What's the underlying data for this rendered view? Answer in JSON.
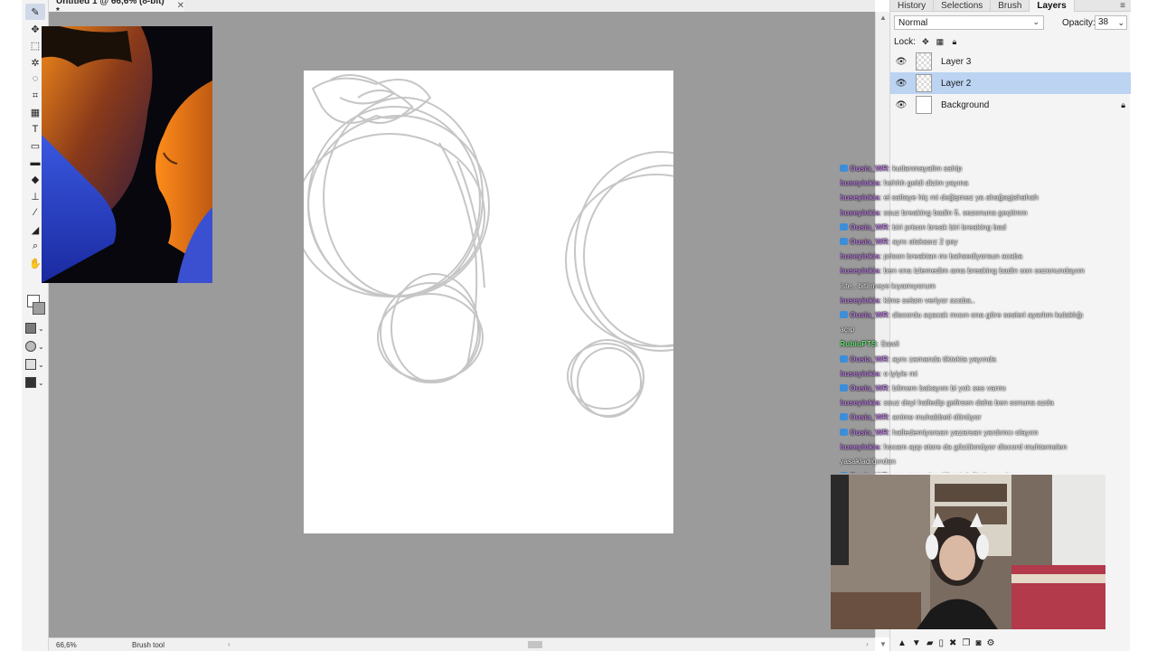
{
  "document": {
    "tab_title": "Untitled 1 @ 66,6% (8-bit) *",
    "close_glyph": "✕"
  },
  "tools": [
    {
      "name": "brush-tool",
      "glyph": "✎",
      "active": true
    },
    {
      "name": "move-tool",
      "glyph": "✥"
    },
    {
      "name": "marquee-tool",
      "glyph": "⬚"
    },
    {
      "name": "magic-wand-tool",
      "glyph": "✲"
    },
    {
      "name": "lasso-tool",
      "glyph": "◌"
    },
    {
      "name": "crop-tool",
      "glyph": "⌗"
    },
    {
      "name": "grid-tool",
      "glyph": "▦"
    },
    {
      "name": "text-tool",
      "glyph": "T"
    },
    {
      "name": "shape-tool",
      "glyph": "▭"
    },
    {
      "name": "gradient-tool",
      "glyph": "▬"
    },
    {
      "name": "eraser-tool",
      "glyph": "◆"
    },
    {
      "name": "clone-stamp-tool",
      "glyph": "⊥"
    },
    {
      "name": "eyedropper-tool",
      "glyph": "⁄"
    },
    {
      "name": "fill-tool",
      "glyph": "◢"
    },
    {
      "name": "zoom-tool",
      "glyph": "⌕"
    },
    {
      "name": "hand-tool",
      "glyph": "✋"
    }
  ],
  "status": {
    "zoom": "66,6%",
    "tool_name": "Brush tool"
  },
  "panel": {
    "tabs": [
      "History",
      "Selections",
      "Brush",
      "Layers"
    ],
    "active_tab": "Layers",
    "menu_glyph": "≡",
    "blend_mode": "Normal",
    "opacity_label": "Opacity:",
    "opacity_value": "38",
    "lock_label": "Lock:",
    "layers": [
      {
        "name": "Layer 3",
        "visible": true,
        "selected": false,
        "locked": false
      },
      {
        "name": "Layer 2",
        "visible": true,
        "selected": true,
        "locked": false
      },
      {
        "name": "Background",
        "visible": true,
        "selected": false,
        "locked": true
      }
    ]
  },
  "chat": [
    {
      "badge": true,
      "user": "Ousia_WR",
      "msg": ": kutlanmayalim sahip"
    },
    {
      "badge": false,
      "user": "huseyinkia",
      "msg": ": hehhh geldi dizim yayına"
    },
    {
      "badge": false,
      "user": "huseyinkia",
      "msg": ": ei saltaye hiç mi değişmez ya ahağaşjahahah"
    },
    {
      "badge": false,
      "user": "huseyinkia",
      "msg": ": ssuz breaking badin 5. sezonuna geçtimm"
    },
    {
      "badge": true,
      "user": "Ousia_WR",
      "msg": ": biri prison break biri breaking bad"
    },
    {
      "badge": true,
      "user": "Ousia_WR",
      "msg": ": aynı alakasız 2 şey"
    },
    {
      "badge": false,
      "user": "huseyinkia",
      "msg": ": prison breaktan mı bahsediyorsun acaba"
    },
    {
      "badge": false,
      "user": "huseyinkia",
      "msg": ": ben ona izlemedim ama breaking badin son sezonundayım"
    },
    {
      "badge": false,
      "user": "",
      "msg": "iste.. bitirmeye kıyamıyorum"
    },
    {
      "badge": false,
      "user": "huseyinkia",
      "msg": ": kime selam veriyor acaba.."
    },
    {
      "badge": true,
      "user": "Ousia_WR",
      "msg": ": discordu açacak mısın ona göre sesleri ayarlım kulaklığı"
    },
    {
      "badge": false,
      "user": "",
      "msg": "açıp"
    },
    {
      "badge": false,
      "user": "RubioPTS",
      "green": true,
      "msg": ": Sawii"
    },
    {
      "badge": true,
      "user": "Ousia_WR",
      "msg": ": aynı zamanda tiktokta yayında"
    },
    {
      "badge": false,
      "user": "huseyinkia",
      "msg": ": o iyiyle mi"
    },
    {
      "badge": true,
      "user": "Ousia_WR",
      "msg": ": bilmem bakayım bi yok ses varmı"
    },
    {
      "badge": false,
      "user": "huseyinkia",
      "msg": ": ssuz deyi halledip gelirsen daha ben sonuna azda"
    },
    {
      "badge": true,
      "user": "Ousia_WR",
      "msg": ": anime muhabbeti dönüyor"
    },
    {
      "badge": true,
      "user": "Ousia_WR",
      "msg": ": halledemiyorsan yazarsan yardımcı olayım"
    },
    {
      "badge": false,
      "user": "huseyinkia",
      "msg": ": hocam app store da gözükmüyor discord muhtemelen"
    },
    {
      "badge": false,
      "user": "",
      "msg": "yasakladığından"
    },
    {
      "badge": true,
      "user": "Ousia_WR",
      "msg": ": app store dan ülkeni değiştirmen lazım"
    }
  ],
  "colors": {
    "canvas_bg": "#9b9b9b",
    "selected_layer": "#bcd3f2",
    "chat_user": "#b57bd9",
    "chat_badge": "#3c8ed8"
  }
}
